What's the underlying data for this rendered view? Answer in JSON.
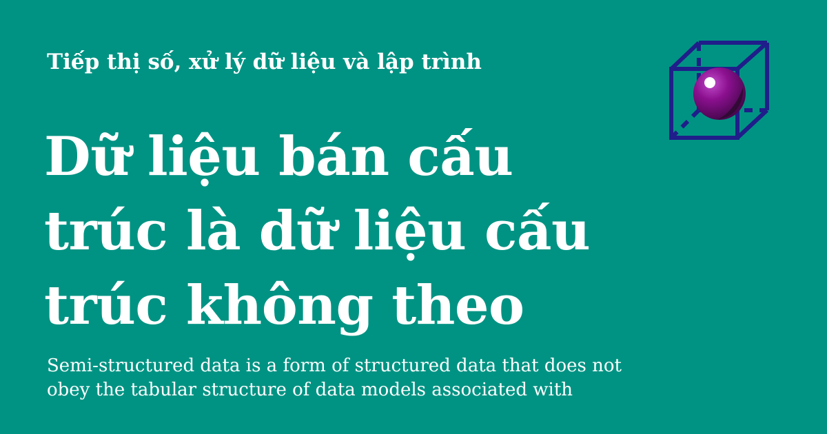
{
  "category": "Tiếp thị số, xử lý dữ liệu và lập trình",
  "title": "Dữ liệu bán cấu trúc là dữ liệu cấu trúc không theo",
  "description": "Semi-structured data is a form of structured data that does not obey the tabular structure of data models associated with",
  "logo": {
    "icon": "cube-sphere-icon",
    "colors": {
      "background": "#009383",
      "cube": "#1f1e8a",
      "sphere": "#8b108f",
      "sphere_shadow": "#2b0a2f"
    }
  }
}
